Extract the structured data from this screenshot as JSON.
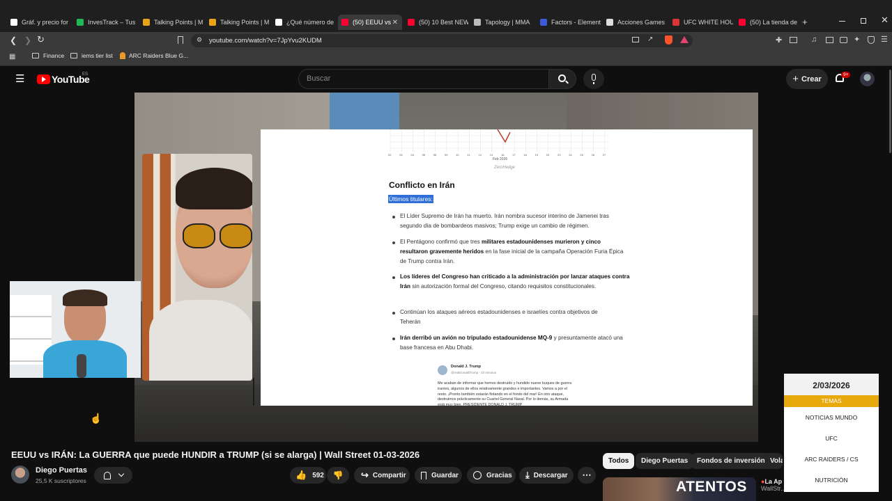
{
  "browser": {
    "tabs": [
      {
        "label": "Gráf. y precio for",
        "color": "#ffffff"
      },
      {
        "label": "InvesTrack – Tus c",
        "color": "#1db954"
      },
      {
        "label": "Talking Points | M",
        "color": "#e8a317"
      },
      {
        "label": "Talking Points | M",
        "color": "#e8a317"
      },
      {
        "label": "¿Qué número de",
        "color": "#ffffff"
      },
      {
        "label": "(50) EEUU vs",
        "color": "#ff0033"
      },
      {
        "label": "(50) 10 Best NEW",
        "color": "#ff0033"
      },
      {
        "label": "Tapology | MMA",
        "color": "#bbbbbb"
      },
      {
        "label": "Factors - Element",
        "color": "#3b5bdb"
      },
      {
        "label": "Acciones Games",
        "color": "#dddddd"
      },
      {
        "label": "UFC WHITE HOU",
        "color": "#d33"
      },
      {
        "label": "(50) La tienda de",
        "color": "#ff0033"
      }
    ],
    "new_tab": "+",
    "url": "youtube.com/watch?v=7JpYvu2KUDM",
    "bookmarks": [
      "Finance",
      "iems tier list",
      "ARC Raiders Blue G..."
    ]
  },
  "youtube": {
    "logo": "YouTube",
    "region": "ES",
    "search_placeholder": "Buscar",
    "create_label": "Crear",
    "notif_count": "9+"
  },
  "doc": {
    "chart_source": "ZeroHedge",
    "chart_month": "Feb 2026",
    "chart_ticks": [
      "02",
      "03",
      "04",
      "05",
      "06",
      "09",
      "10",
      "11",
      "12",
      "13",
      "16",
      "17",
      "18",
      "19",
      "20",
      "23",
      "24",
      "25",
      "26",
      "27"
    ],
    "heading": "Conflicto en Irán",
    "subheading": "Últimos titulares:",
    "bullets": [
      {
        "bold": "",
        "text": "El Líder Supremo de Irán ha muerto. Irán nombra sucesor interino de Jamenei tras segundo día de bombardeos masivos; Trump exige un cambio de régimen."
      },
      {
        "pre": "El Pentágono confirmó que tres ",
        "bold": "militares estadounidenses murieron y cinco resultaron gravemente heridos",
        "text": " en la fase inicial de la campaña Operación Furia Épica de Trump contra Irán."
      },
      {
        "pre": "",
        "bold": "Los líderes del Congreso han criticado a la administración por lanzar ataques contra Irán",
        "text": " sin autorización formal del Congreso, citando requisitos constitucionales."
      },
      {
        "pre": "",
        "bold": "",
        "text": "Continúan los ataques aéreos estadounidenses e israelíes contra objetivos de Teherán"
      },
      {
        "pre": "",
        "bold": "Irán derribó un avión no tripulado estadounidense MQ-9",
        "text": " y presuntamente atacó una base francesa en Abu Dhabi."
      }
    ],
    "tweet_author": "Donald J. Trump",
    "tweet_handle": "@realDonaldTrump · 33 minutos",
    "tweet_text": "Me acaban de informar que hemos destruido y hundido nueve buques de guerra iraníes, algunos de ellos relativamente grandes e importantes. Vamos a por el resto. ¡Pronto también estarán flotando en el fondo del mar! En otro ataque, destruimos prácticamente su Cuartel General Naval. Por lo demás, su Armada está muy bien. PRESIDENTE DONALD J. TRUMP"
  },
  "news_overlay": {
    "date": "2/03/2026",
    "header": "TEMAS",
    "items": [
      "NOTICIAS MUNDO",
      "UFC",
      "ARC RAIDERS / CS",
      "NUTRICIÓN"
    ],
    "accent": "#e8a90c"
  },
  "video": {
    "title": "EEUU vs IRÁN: La GUERRA que puede HUNDIR a TRUMP (si se alarga) | Wall Street 01-03-2026",
    "channel": "Diego Puertas",
    "subscribers": "25,5 K suscriptores",
    "likes": "592",
    "share": "Compartir",
    "save": "Guardar",
    "thanks": "Gracias",
    "download": "Descargar"
  },
  "chips": [
    "Todos",
    "Diego Puertas",
    "Fondos de inversión",
    "Vola"
  ],
  "recommend": {
    "thumb_text": "ATENTOS",
    "title_start": "La Ap",
    "title_next": "WallStr..."
  }
}
